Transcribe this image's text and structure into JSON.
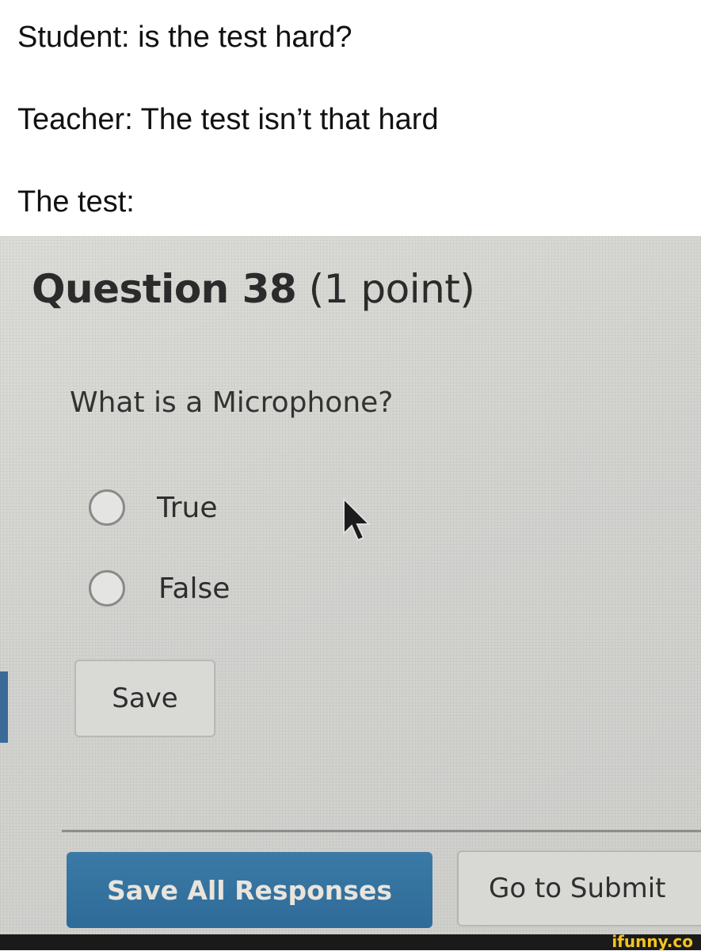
{
  "caption": {
    "line1": "Student: is the test hard?",
    "line2": "Teacher: The test isn’t that hard",
    "line3": "The test:"
  },
  "quiz": {
    "title_bold": "Question 38",
    "title_points": "(1 point)",
    "question": "What is a Microphone?",
    "options": [
      {
        "label": "True",
        "selected": false
      },
      {
        "label": "False",
        "selected": false
      }
    ],
    "save_label": "Save",
    "save_all_label": "Save All Responses",
    "go_to_submit_label": "Go to Submit",
    "accent_color": "#3471a0"
  },
  "watermark": {
    "text": "ifunny.co",
    "color": "#f3c521"
  }
}
